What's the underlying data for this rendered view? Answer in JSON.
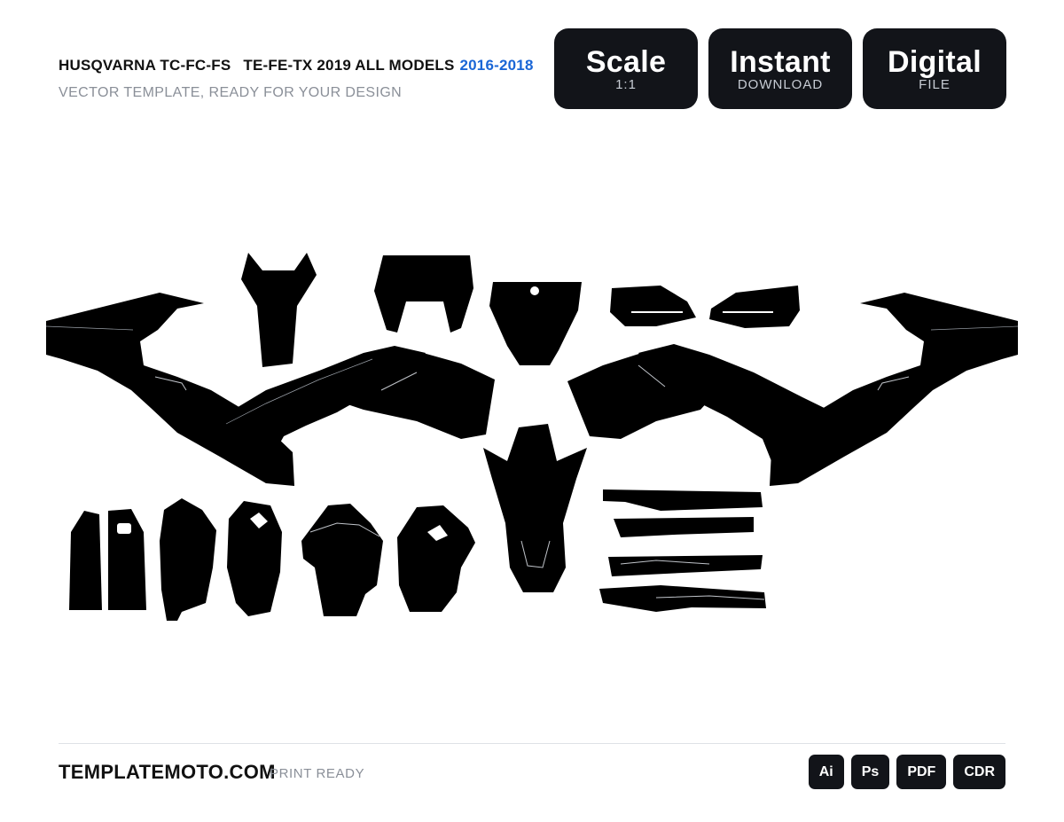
{
  "header": {
    "title_part1": "HUSQVARNA TC-FC-FS",
    "title_part2": "TE-FE-TX 2019 ALL MODELS",
    "years": "2016-2018",
    "subtitle": "VECTOR TEMPLATE, READY FOR YOUR DESIGN"
  },
  "badges": [
    {
      "big": "Scale",
      "small": "1:1"
    },
    {
      "big": "Instant",
      "small": "DOWNLOAD"
    },
    {
      "big": "Digital",
      "small": "FILE"
    }
  ],
  "footer": {
    "site": "TEMPLATEMOTO.COM",
    "print": "PRINT READY",
    "formats": [
      "Ai",
      "Ps",
      "PDF",
      "CDR"
    ]
  },
  "colors": {
    "accent": "#1a66d6",
    "badge_bg": "#121419",
    "shape_fill": "#000000",
    "muted_text": "#8a8f98"
  }
}
